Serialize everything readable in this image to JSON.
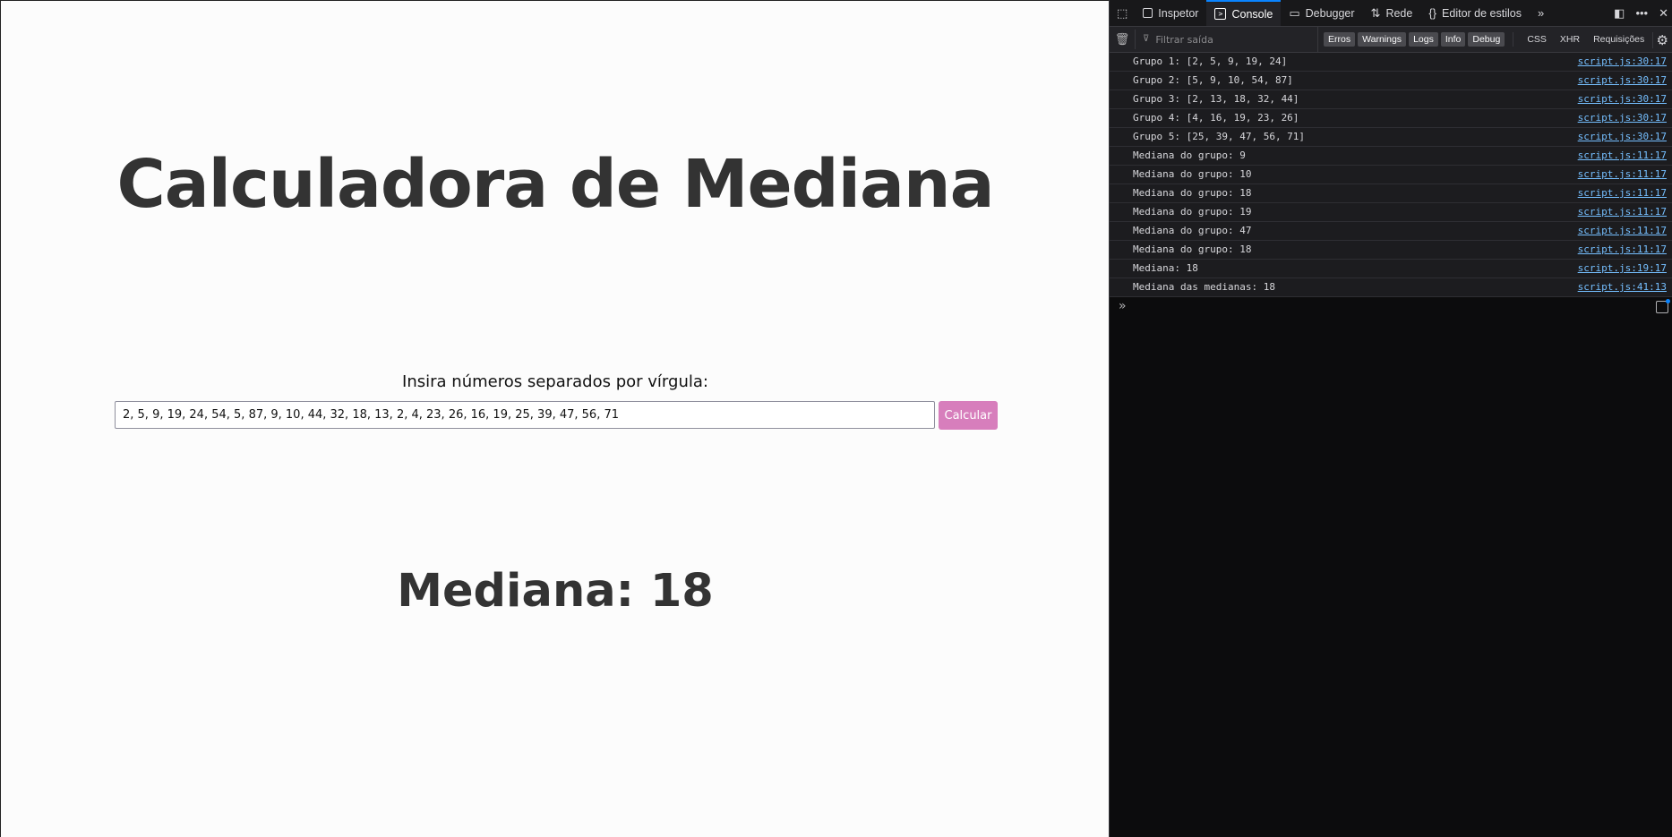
{
  "page": {
    "title": "Calculadora de Mediana",
    "input_label": "Insira números separados por vírgula:",
    "input_value": "2, 5, 9, 19, 24, 54, 5, 87, 9, 10, 44, 32, 18, 13, 2, 4, 23, 26, 16, 19, 25, 39, 47, 56, 71",
    "button_label": "Calcular",
    "result": "Mediana: 18",
    "button_color": "#d77ebc"
  },
  "devtools": {
    "tabs": [
      {
        "label": "Inspetor",
        "icon": "inspector-icon"
      },
      {
        "label": "Console",
        "icon": "console-icon",
        "active": true
      },
      {
        "label": "Debugger",
        "icon": "debugger-icon"
      },
      {
        "label": "Rede",
        "icon": "network-icon"
      },
      {
        "label": "Editor de estilos",
        "icon": "style-editor-icon"
      }
    ],
    "filter_placeholder": "Filtrar saída",
    "filter_buttons": [
      "Erros",
      "Warnings",
      "Logs",
      "Info",
      "Debug"
    ],
    "request_buttons": [
      "CSS",
      "XHR",
      "Requisições"
    ],
    "logs": [
      {
        "msg": "Grupo 1: [2, 5, 9, 19, 24]",
        "src": "script.js:30:17"
      },
      {
        "msg": "Grupo 2: [5, 9, 10, 54, 87]",
        "src": "script.js:30:17"
      },
      {
        "msg": "Grupo 3: [2, 13, 18, 32, 44]",
        "src": "script.js:30:17"
      },
      {
        "msg": "Grupo 4: [4, 16, 19, 23, 26]",
        "src": "script.js:30:17"
      },
      {
        "msg": "Grupo 5: [25, 39, 47, 56, 71]",
        "src": "script.js:30:17"
      },
      {
        "msg": "Mediana do grupo: 9",
        "src": "script.js:11:17"
      },
      {
        "msg": "Mediana do grupo: 10",
        "src": "script.js:11:17"
      },
      {
        "msg": "Mediana do grupo: 18",
        "src": "script.js:11:17"
      },
      {
        "msg": "Mediana do grupo: 19",
        "src": "script.js:11:17"
      },
      {
        "msg": "Mediana do grupo: 47",
        "src": "script.js:11:17"
      },
      {
        "msg": "Mediana do grupo: 18",
        "src": "script.js:11:17"
      },
      {
        "msg": "Mediana: 18",
        "src": "script.js:19:17"
      },
      {
        "msg": "Mediana das medianas: 18",
        "src": "script.js:41:13"
      }
    ],
    "accent_color": "#0a84ff",
    "link_color": "#75bfff"
  }
}
